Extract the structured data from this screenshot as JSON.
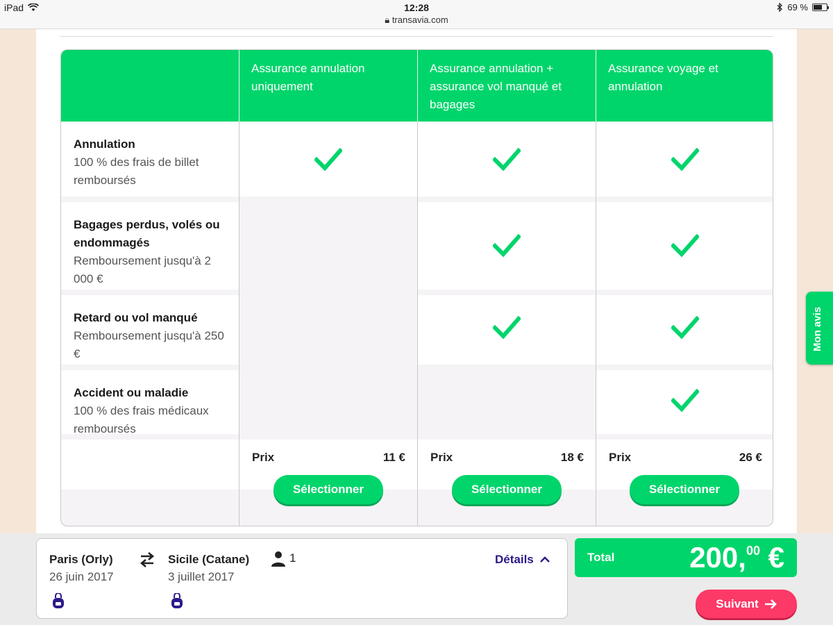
{
  "statusbar": {
    "device": "iPad",
    "time": "12:28",
    "url": "transavia.com",
    "battery": "69 %",
    "battery_fraction": 0.69
  },
  "table": {
    "columns": [
      {
        "title": "Assurance annulation uniquement"
      },
      {
        "title": "Assurance annulation + assurance vol manqué et bagages"
      },
      {
        "title": "Assurance voyage et annulation"
      }
    ],
    "rows": [
      {
        "title": "Annulation",
        "desc": "100 % des frais de billet remboursés",
        "checks": [
          true,
          true,
          true
        ]
      },
      {
        "title": "Bagages perdus, volés ou endommagés",
        "desc": "Remboursement jusqu'à 2 000 €",
        "checks": [
          false,
          true,
          true
        ]
      },
      {
        "title": "Retard ou vol manqué",
        "desc": "Remboursement jusqu'à 250 €",
        "checks": [
          false,
          true,
          true
        ]
      },
      {
        "title": "Accident ou maladie",
        "desc": "100 % des frais médicaux remboursés",
        "checks": [
          false,
          false,
          true
        ]
      }
    ],
    "price_label": "Prix",
    "prices": [
      "11 €",
      "18 €",
      "26 €"
    ],
    "select_label": "Sélectionner"
  },
  "sidetab": {
    "label": "Mon avis"
  },
  "trip": {
    "from_city": "Paris (Orly)",
    "from_date": "26 juin 2017",
    "to_city": "Sicile (Catane)",
    "to_date": "3 juillet 2017",
    "passengers": "1",
    "details_label": "Détails"
  },
  "total": {
    "label": "Total",
    "amount_main": "200,",
    "amount_cents": "00",
    "currency": "€"
  },
  "next": {
    "label": "Suivant"
  },
  "colors": {
    "green": "#00d56b",
    "pink": "#fc3967",
    "purple": "#2c1a8a"
  }
}
